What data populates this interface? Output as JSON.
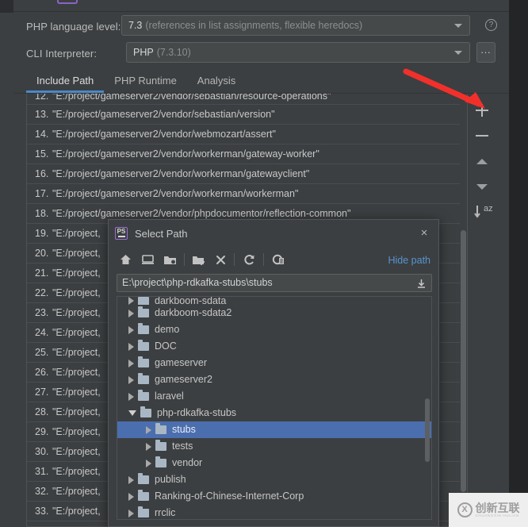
{
  "settings": {
    "php_language_level_label": "PHP language level:",
    "php_language_level_value_strong": "7.3",
    "php_language_level_value_dim": "(references in list assignments, flexible heredocs)",
    "cli_interpreter_label": "CLI Interpreter:",
    "cli_interpreter_value_strong": "PHP",
    "cli_interpreter_value_dim": "(7.3.10)",
    "help_icon_glyph": "?",
    "browse_button_label": "...",
    "tabs": [
      {
        "label": "Include Path",
        "active": true
      },
      {
        "label": "PHP Runtime",
        "active": false
      },
      {
        "label": "Analysis",
        "active": false
      }
    ]
  },
  "include_path_list": {
    "rows": [
      {
        "num": "12.",
        "path": "\"E:/project/gameserver2/vendor/sebastian/resource-operations\""
      },
      {
        "num": "13.",
        "path": "\"E:/project/gameserver2/vendor/sebastian/version\""
      },
      {
        "num": "14.",
        "path": "\"E:/project/gameserver2/vendor/webmozart/assert\""
      },
      {
        "num": "15.",
        "path": "\"E:/project/gameserver2/vendor/workerman/gateway-worker\""
      },
      {
        "num": "16.",
        "path": "\"E:/project/gameserver2/vendor/workerman/gatewayclient\""
      },
      {
        "num": "17.",
        "path": "\"E:/project/gameserver2/vendor/workerman/workerman\""
      },
      {
        "num": "18.",
        "path": "\"E:/project/gameserver2/vendor/phpdocumentor/reflection-common\""
      },
      {
        "num": "19.",
        "path": "\"E:/project,"
      },
      {
        "num": "20.",
        "path": "\"E:/project,"
      },
      {
        "num": "21.",
        "path": "\"E:/project,"
      },
      {
        "num": "22.",
        "path": "\"E:/project,"
      },
      {
        "num": "23.",
        "path": "\"E:/project,"
      },
      {
        "num": "24.",
        "path": "\"E:/project,"
      },
      {
        "num": "25.",
        "path": "\"E:/project,"
      },
      {
        "num": "26.",
        "path": "\"E:/project,"
      },
      {
        "num": "27.",
        "path": "\"E:/project,"
      },
      {
        "num": "28.",
        "path": "\"E:/project,"
      },
      {
        "num": "29.",
        "path": "\"E:/project,"
      },
      {
        "num": "30.",
        "path": "\"E:/project,"
      },
      {
        "num": "31.",
        "path": "\"E:/project,"
      },
      {
        "num": "32.",
        "path": "\"E:/project,"
      },
      {
        "num": "33.",
        "path": "\"E:/project,"
      }
    ]
  },
  "side_toolbar": {
    "add_label": "+",
    "remove_label": "−",
    "move_up_label": "Move Up",
    "move_down_label": "Move Down",
    "sort_label": "az"
  },
  "annotation": {
    "arrow_color": "#f2302b",
    "points_to": "add-path-button"
  },
  "dialog": {
    "title": "Select Path",
    "close_glyph": "×",
    "app_icon_label": "PS",
    "hide_path_label": "Hide path",
    "path_value": "E:\\project\\php-rdkafka-stubs\\stubs",
    "toolbar_icons": [
      "home-icon",
      "desktop-icon",
      "project-folder-icon",
      "new-folder-icon",
      "delete-icon",
      "refresh-icon",
      "show-hidden-files-icon"
    ],
    "tree": [
      {
        "label": "darkboom-sdata",
        "indent": 0,
        "state": "closed",
        "selected": false,
        "clip": "top"
      },
      {
        "label": "darkboom-sdata2",
        "indent": 0,
        "state": "closed",
        "selected": false
      },
      {
        "label": "demo",
        "indent": 0,
        "state": "closed",
        "selected": false
      },
      {
        "label": "DOC",
        "indent": 0,
        "state": "closed",
        "selected": false
      },
      {
        "label": "gameserver",
        "indent": 0,
        "state": "closed",
        "selected": false
      },
      {
        "label": "gameserver2",
        "indent": 0,
        "state": "closed",
        "selected": false
      },
      {
        "label": "laravel",
        "indent": 0,
        "state": "closed",
        "selected": false
      },
      {
        "label": "php-rdkafka-stubs",
        "indent": 0,
        "state": "open",
        "selected": false
      },
      {
        "label": "stubs",
        "indent": 1,
        "state": "closed",
        "selected": true
      },
      {
        "label": "tests",
        "indent": 1,
        "state": "closed",
        "selected": false
      },
      {
        "label": "vendor",
        "indent": 1,
        "state": "closed",
        "selected": false
      },
      {
        "label": "publish",
        "indent": 0,
        "state": "closed",
        "selected": false
      },
      {
        "label": "Ranking-of-Chinese-Internet-Corp",
        "indent": 0,
        "state": "closed",
        "selected": false
      },
      {
        "label": "rrclic",
        "indent": 0,
        "state": "closed",
        "selected": false
      },
      {
        "label": "",
        "indent": 0,
        "state": "closed",
        "selected": false,
        "clip": "bot"
      }
    ]
  },
  "watermark": {
    "mark": "X",
    "text": "创新互联",
    "subtext": "CHUANGXIN HULIAN"
  },
  "colors": {
    "panel_bg": "#3c3f41",
    "outer_bg": "#232527",
    "field_bg": "#45494a",
    "accent_tab": "#4a88c7",
    "selection_blue": "#4b6eaf",
    "link_blue": "#5794d0",
    "arrow_red": "#f2302b"
  }
}
